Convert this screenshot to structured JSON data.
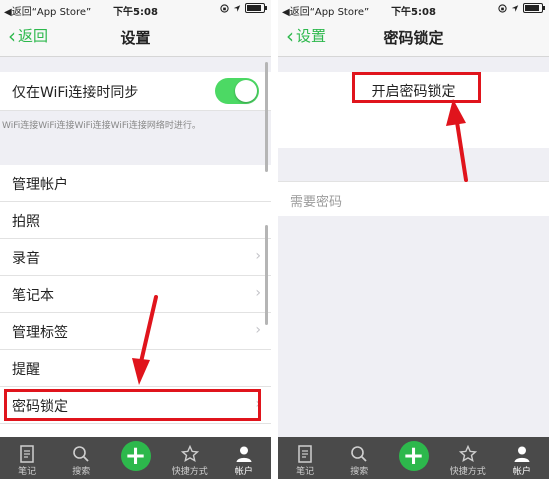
{
  "status": {
    "back": "◀返回“App Store”",
    "time": "下午5:08"
  },
  "left": {
    "nav": {
      "back_label": "返回",
      "title": "设置"
    },
    "wifi_label": "仅在WiFi连接时同步",
    "wifi_note": "WiFi连接WiFi连接WiFi连接WiFi连接网络时进行。",
    "items": [
      "管理帐户",
      "拍照",
      "录音",
      "笔记本",
      "管理标签",
      "提醒",
      "密码锁定"
    ]
  },
  "right": {
    "nav": {
      "back_label": "设置",
      "title": "密码锁定"
    },
    "enable_label": "开启密码锁定",
    "require_label": "需要密码"
  },
  "tabs": [
    "笔记",
    "搜索",
    "快捷方式",
    "帐户"
  ],
  "colors": {
    "accent": "#2db84c",
    "toggle": "#4cd964",
    "annotation": "#e0141c",
    "tabbar": "#4a4a4a"
  }
}
